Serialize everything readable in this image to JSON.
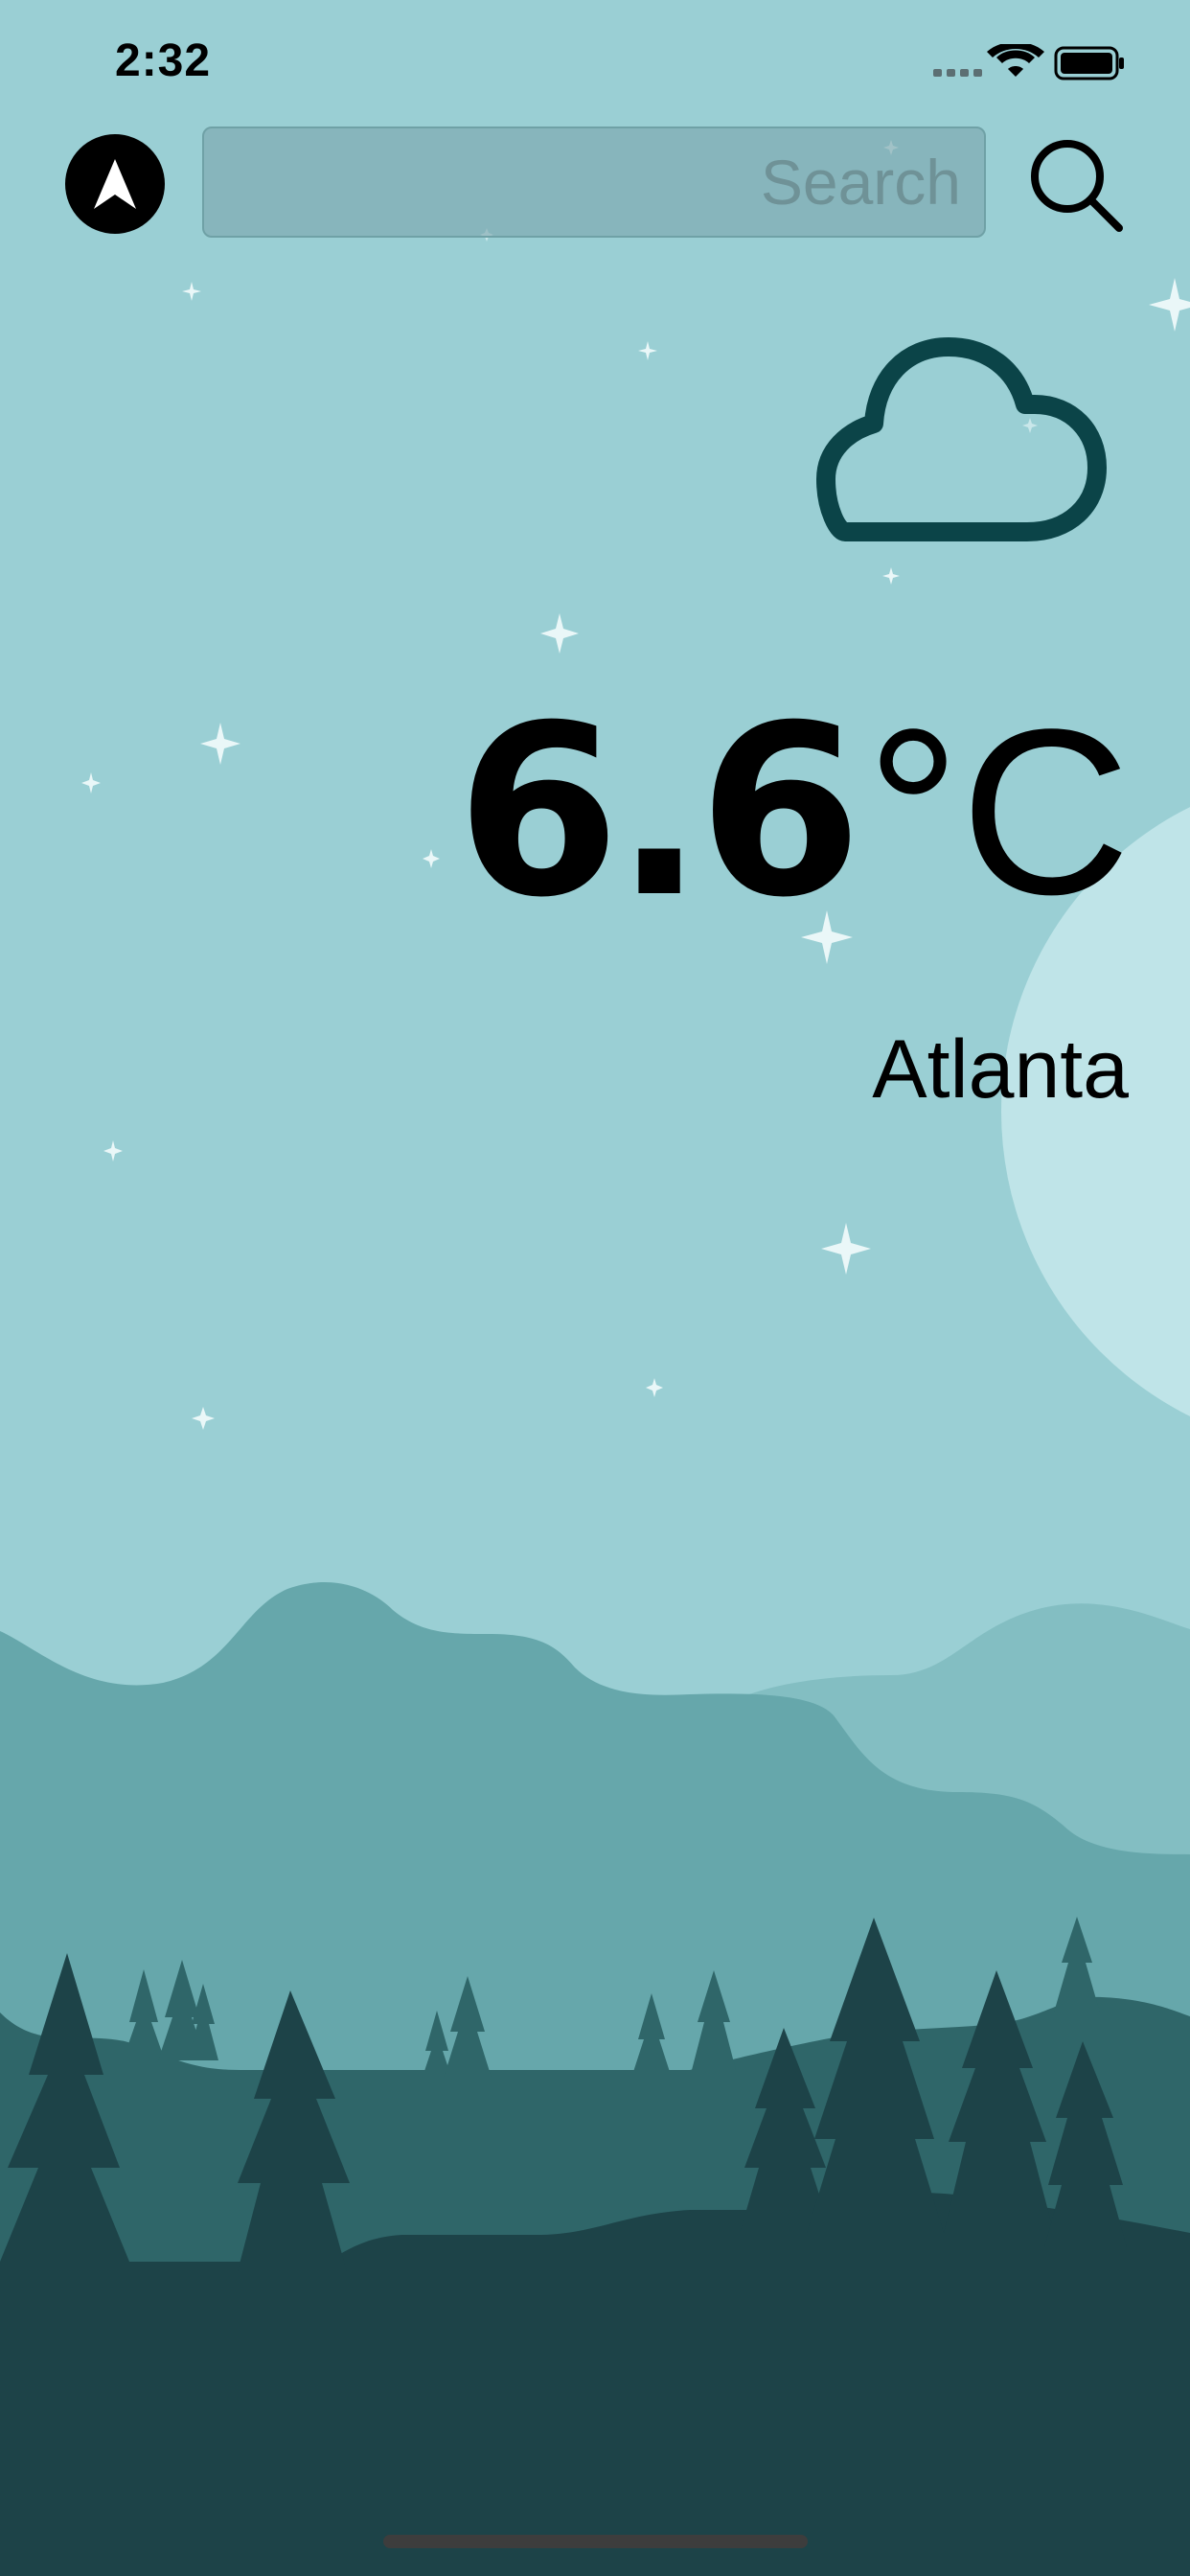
{
  "status_bar": {
    "time": "2:32",
    "icons": [
      "signal-icon",
      "wifi-icon",
      "battery-icon"
    ]
  },
  "toolbar": {
    "location_icon": "location-arrow-icon",
    "search": {
      "value": "",
      "placeholder": "Search"
    },
    "search_icon": "search-icon"
  },
  "weather": {
    "condition_icon": "cloud-icon",
    "temperature_value": "6.6",
    "temperature_unit": "°C",
    "city": "Atlanta"
  },
  "colors": {
    "sky": "#9acfd4",
    "moon": "#bfe4e8",
    "cloud_outline": "#0b4448",
    "hills_far": "#83bec2",
    "hills_mid": "#66a7ab",
    "hills_near": "#2f6669",
    "ground": "#1d4348",
    "trees_dark": "#1d4348",
    "trees_light": "#2f6669"
  }
}
